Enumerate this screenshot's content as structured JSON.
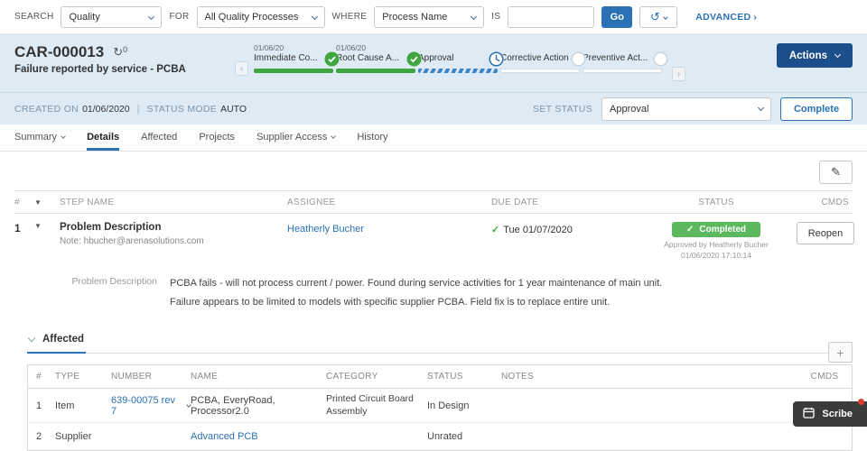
{
  "icons": {
    "check": "✓",
    "history": "↺",
    "refresh": "↻",
    "pencil": "✎",
    "plus": "+",
    "filter": "▼",
    "chevron_left": "‹",
    "chevron_right": "›"
  },
  "colors": {
    "accent_blue": "#2a72b5",
    "dark_blue": "#1c4e8c",
    "green": "#3fa53f",
    "badge_green": "#5cb85c",
    "header_bg": "#deebf4"
  },
  "search_bar": {
    "search_label": "SEARCH",
    "search_value": "Quality",
    "for_label": "FOR",
    "for_value": "All Quality Processes",
    "where_label": "WHERE",
    "where_value": "Process Name",
    "is_label": "IS",
    "is_value": "",
    "go_label": "Go",
    "advanced_label": "ADVANCED"
  },
  "header": {
    "record_id": "CAR-000013",
    "refresh_count": "0",
    "subtitle": "Failure reported by service - PCBA",
    "actions_label": "Actions",
    "steps": [
      {
        "date": "01/06/20",
        "label": "Immediate Co...",
        "state": "complete"
      },
      {
        "date": "01/06/20",
        "label": "Root Cause A...",
        "state": "complete"
      },
      {
        "date": "",
        "label": "Approval",
        "state": "in-progress"
      },
      {
        "date": "",
        "label": "Corrective Action",
        "state": "pending"
      },
      {
        "date": "",
        "label": "Preventive Act...",
        "state": "pending"
      }
    ]
  },
  "status_row": {
    "created_label": "CREATED ON",
    "created_value": "01/06/2020",
    "separator": "|",
    "mode_label": "STATUS MODE",
    "mode_value": "AUTO",
    "set_status_label": "SET STATUS",
    "set_status_value": "Approval",
    "complete_label": "Complete"
  },
  "tabs": [
    {
      "label": "Summary"
    },
    {
      "label": "Details"
    },
    {
      "label": "Affected"
    },
    {
      "label": "Projects"
    },
    {
      "label": "Supplier Access"
    },
    {
      "label": "History"
    }
  ],
  "steps_table": {
    "headers": {
      "num": "#",
      "step_name": "STEP NAME",
      "assignee": "ASSIGNEE",
      "due_date": "DUE DATE",
      "status": "STATUS",
      "cmds": "CMDS"
    },
    "rows": [
      {
        "num": "1",
        "name": "Problem Description",
        "note": "Note: hbucher@arenasolutions.com",
        "assignee": "Heatherly Bucher",
        "due_date": "Tue 01/07/2020",
        "status_badge": "Completed",
        "status_by": "Approved by Heatherly Bucher",
        "status_time": "01/06/2020 17:10:14",
        "cmd_label": "Reopen"
      }
    ],
    "detail": {
      "label": "Problem Description",
      "text": "PCBA fails - will not process current / power. Found during service activities for 1 year maintenance of main unit. Failure appears to be limited to models with specific supplier PCBA. Field fix is to replace entire unit."
    }
  },
  "affected": {
    "title": "Affected",
    "headers": {
      "num": "#",
      "type": "TYPE",
      "number": "NUMBER",
      "name": "NAME",
      "category": "CATEGORY",
      "status": "STATUS",
      "notes": "NOTES",
      "cmds": "CMDS"
    },
    "rows": [
      {
        "num": "1",
        "type": "Item",
        "number": "639-00075 rev 7",
        "name": "PCBA, EveryRoad, Processor2.0",
        "category": "Printed Circuit Board Assembly",
        "status": "In Design",
        "notes": "",
        "cmds": "•••"
      },
      {
        "num": "2",
        "type": "Supplier",
        "number": "",
        "name": "Advanced PCB",
        "category": "",
        "status": "Unrated",
        "notes": "",
        "cmds": ""
      }
    ]
  },
  "scribe": {
    "label": "Scribe"
  }
}
